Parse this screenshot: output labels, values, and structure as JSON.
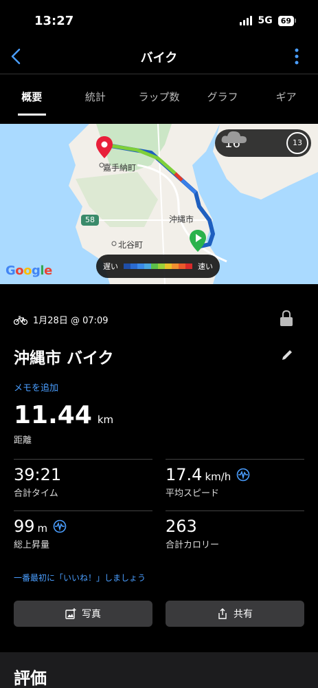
{
  "status": {
    "time": "13:27",
    "network": "5G",
    "battery": "69"
  },
  "nav": {
    "title": "バイク"
  },
  "tabs": [
    {
      "label": "概要"
    },
    {
      "label": "統計"
    },
    {
      "label": "ラップ数"
    },
    {
      "label": "グラフ"
    },
    {
      "label": "ギア"
    }
  ],
  "map": {
    "labels": {
      "kadena": "嘉手納町",
      "okinawa": "沖縄市",
      "chatan": "北谷町",
      "route": "58"
    },
    "weather": {
      "temp": "16°",
      "wind": "13"
    },
    "legend": {
      "slow": "遅い",
      "fast": "速い"
    },
    "attribution": "Google"
  },
  "activity": {
    "date": "1月28日 @ 07:09",
    "title": "沖縄市 バイク",
    "add_note": "メモを追加",
    "distance": {
      "value": "11.44",
      "unit": "km",
      "label": "距離"
    },
    "stats": {
      "time": {
        "value": "39:21",
        "label": "合計タイム"
      },
      "speed": {
        "value": "17.4",
        "unit": "km/h",
        "label": "平均スピード"
      },
      "ascent": {
        "value": "99",
        "unit": "m",
        "label": "総上昇量"
      },
      "calories": {
        "value": "263",
        "label": "合計カロリー"
      }
    },
    "like_prompt": "一番最初に「いいね！」しましょう",
    "buttons": {
      "photo": "写真",
      "share": "共有"
    }
  },
  "rating": {
    "title": "評価"
  },
  "colors": {
    "accent": "#4a9eff",
    "start": "#2bb24c",
    "end": "#e8203a"
  }
}
